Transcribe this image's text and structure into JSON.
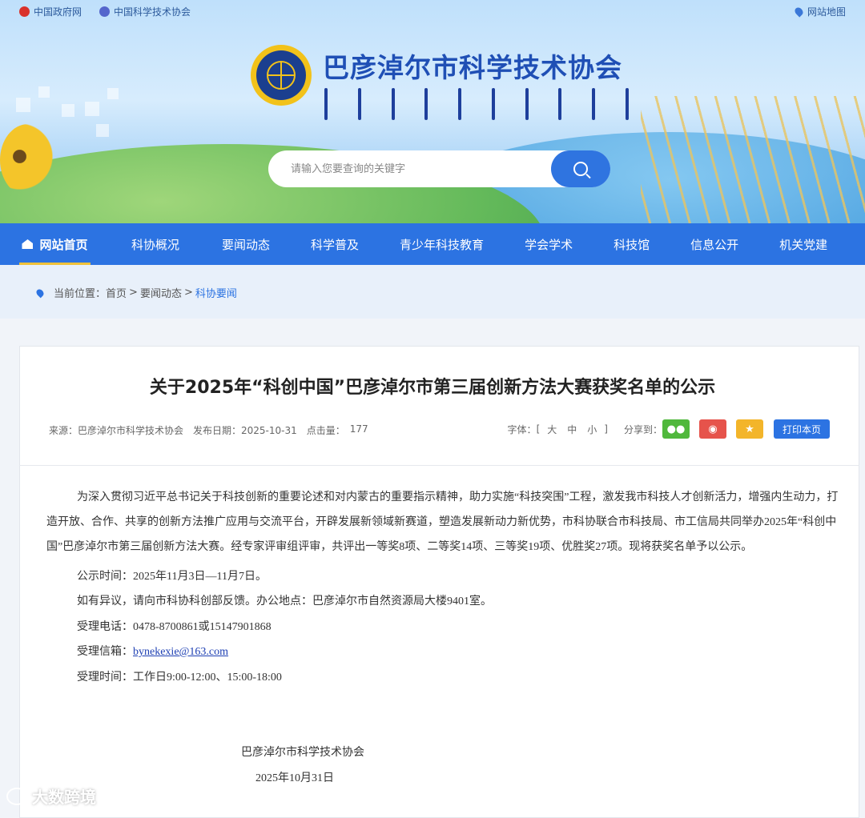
{
  "topbar": {
    "links": [
      {
        "label": "中国政府网",
        "icon": "gov-emblem-icon",
        "color": "#d9312b"
      },
      {
        "label": "中国科学技术协会",
        "icon": "cast-logo-icon",
        "color": "#5566cc"
      }
    ],
    "sitemap": "网站地图"
  },
  "header": {
    "title": "巴彦淖尔市科学技术协会",
    "logo_icon": "cast-emblem-icon"
  },
  "search": {
    "placeholder": "请输入您要查询的关键字",
    "button_icon": "search-icon"
  },
  "nav": {
    "items": [
      {
        "label": "网站首页",
        "active": true
      },
      {
        "label": "科协概况"
      },
      {
        "label": "要闻动态"
      },
      {
        "label": "科学普及"
      },
      {
        "label": "青少年科技教育"
      },
      {
        "label": "学会学术"
      },
      {
        "label": "科技馆"
      },
      {
        "label": "信息公开"
      },
      {
        "label": "机关党建"
      }
    ]
  },
  "breadcrumb": {
    "prefix": "当前位置：",
    "items": [
      "首页",
      "要闻动态",
      "科协要闻"
    ],
    "separator": ">"
  },
  "article": {
    "title": "关于2025年“科创中国”巴彦淖尔市第三届创新方法大赛获奖名单的公示",
    "source": "来源：巴彦淖尔市科学技术协会",
    "date": "发布日期：2025-10-31",
    "hits_label": "点击量：",
    "hits": "177",
    "font_label": "字体：",
    "font_open": "[",
    "font_large": "大",
    "font_medium": "中",
    "font_small": "小",
    "font_close": "]",
    "share_label": "分享到：",
    "print_label": "打印本页",
    "body": "为深入贯彻习近平总书记关于科技创新的重要论述和对内蒙古的重要指示精神，助力实施“科技突围”工程，激发我市科技人才创新活力，增强内生动力，打造开放、合作、共享的创新方法推广应用与交流平台，开辟发展新领域新赛道，塑造发展新动力新优势，市科协联合市科技局、市工信局共同举办2025年“科创中国”巴彦淖尔市第三届创新方法大赛。经专家评审组评审，共评出一等奖8项、二等奖14项、三等奖19项、优胜奖27项。现将获奖名单予以公示。",
    "period": "公示时间：2025年11月3日—11月7日。",
    "objection": "如有异议，请向市科协科创部反馈。办公地点：巴彦淖尔市自然资源局大楼9401室。",
    "phone": "受理电话：0478-8700861或15147901868",
    "email_label": "受理信箱：",
    "email": "bynekexie@163.com",
    "hours": "受理时间：工作日9:00-12:00、15:00-18:00",
    "signature": "巴彦淖尔市科学技术协会",
    "sign_date": "2025年10月31日"
  },
  "watermark": "大数跨境"
}
